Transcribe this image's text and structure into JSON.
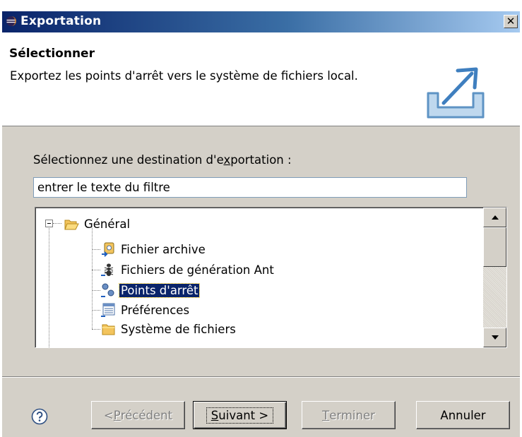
{
  "window": {
    "title": "Exportation",
    "close_label": "✕"
  },
  "header": {
    "title": "Sélectionner",
    "description": "Exportez les points d'arrêt vers le système de fichiers local."
  },
  "destination": {
    "label_before": "Sélectionnez une destination d'e",
    "label_mnemonic": "x",
    "label_after": "portation :",
    "filter_value": "entrer le texte du filtre"
  },
  "tree": {
    "root": {
      "label": "Général",
      "icon": "folder-open-icon",
      "expanded": true
    },
    "children": [
      {
        "label": "Fichier archive",
        "icon": "archive-file-icon",
        "selected": false
      },
      {
        "label": "Fichiers de génération Ant",
        "icon": "ant-icon",
        "selected": false
      },
      {
        "label": "Points d'arrêt",
        "icon": "breakpoints-icon",
        "selected": true
      },
      {
        "label": "Préférences",
        "icon": "preferences-icon",
        "selected": false
      },
      {
        "label": "Système de fichiers",
        "icon": "folder-icon",
        "selected": false
      }
    ]
  },
  "buttons": {
    "back": {
      "label_prefix": "< ",
      "mnemonic": "P",
      "label_rest": "récédent",
      "enabled": false
    },
    "next": {
      "mnemonic": "S",
      "label_rest": "uivant >",
      "enabled": true,
      "default": true
    },
    "finish": {
      "mnemonic": "T",
      "label_rest": "erminer",
      "enabled": false
    },
    "cancel": {
      "label": "Annuler",
      "enabled": true
    }
  },
  "colors": {
    "titlebar_start": "#0a246a",
    "titlebar_end": "#a6caf0",
    "selection": "#0a246a",
    "dialog_bg": "#d4d0c8"
  }
}
